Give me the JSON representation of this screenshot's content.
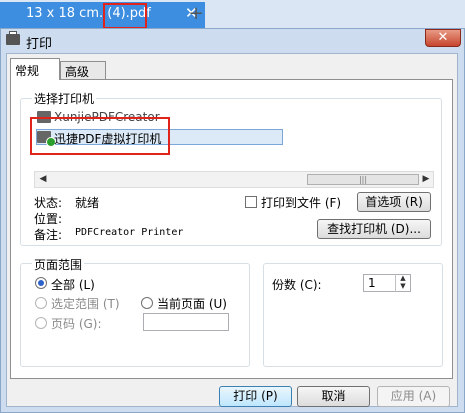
{
  "browser_tab": {
    "title": "13 x 18 cm. (4).pdf",
    "close_glyph": "✕",
    "new_tab_glyph": "+"
  },
  "dialog": {
    "title": "打印",
    "close_glyph": "✕"
  },
  "tabs": [
    {
      "label": "常规"
    },
    {
      "label": "高级"
    }
  ],
  "select_printer": {
    "legend": "选择打印机",
    "printers": [
      {
        "name": "XunjiePDFCreator"
      },
      {
        "name": "迅捷PDF虚拟打印机"
      }
    ]
  },
  "status": {
    "status_label": "状态:",
    "status_value": "就绪",
    "location_label": "位置:",
    "location_value": "",
    "comment_label": "备注:",
    "comment_value": "PDFCreator Printer"
  },
  "print_to_file_label": "打印到文件 (F)",
  "preferences_button": "首选项 (R)",
  "find_printer_button": "查找打印机 (D)...",
  "page_range": {
    "legend": "页面范围",
    "all": "全部 (L)",
    "selection": "选定范围 (T)",
    "current_page": "当前页面 (U)",
    "pages": "页码 (G):",
    "pages_value": ""
  },
  "copies": {
    "label": "份数 (C):",
    "value": "1"
  },
  "buttons": {
    "print": "打印 (P)",
    "cancel": "取消",
    "apply": "应用 (A)"
  }
}
